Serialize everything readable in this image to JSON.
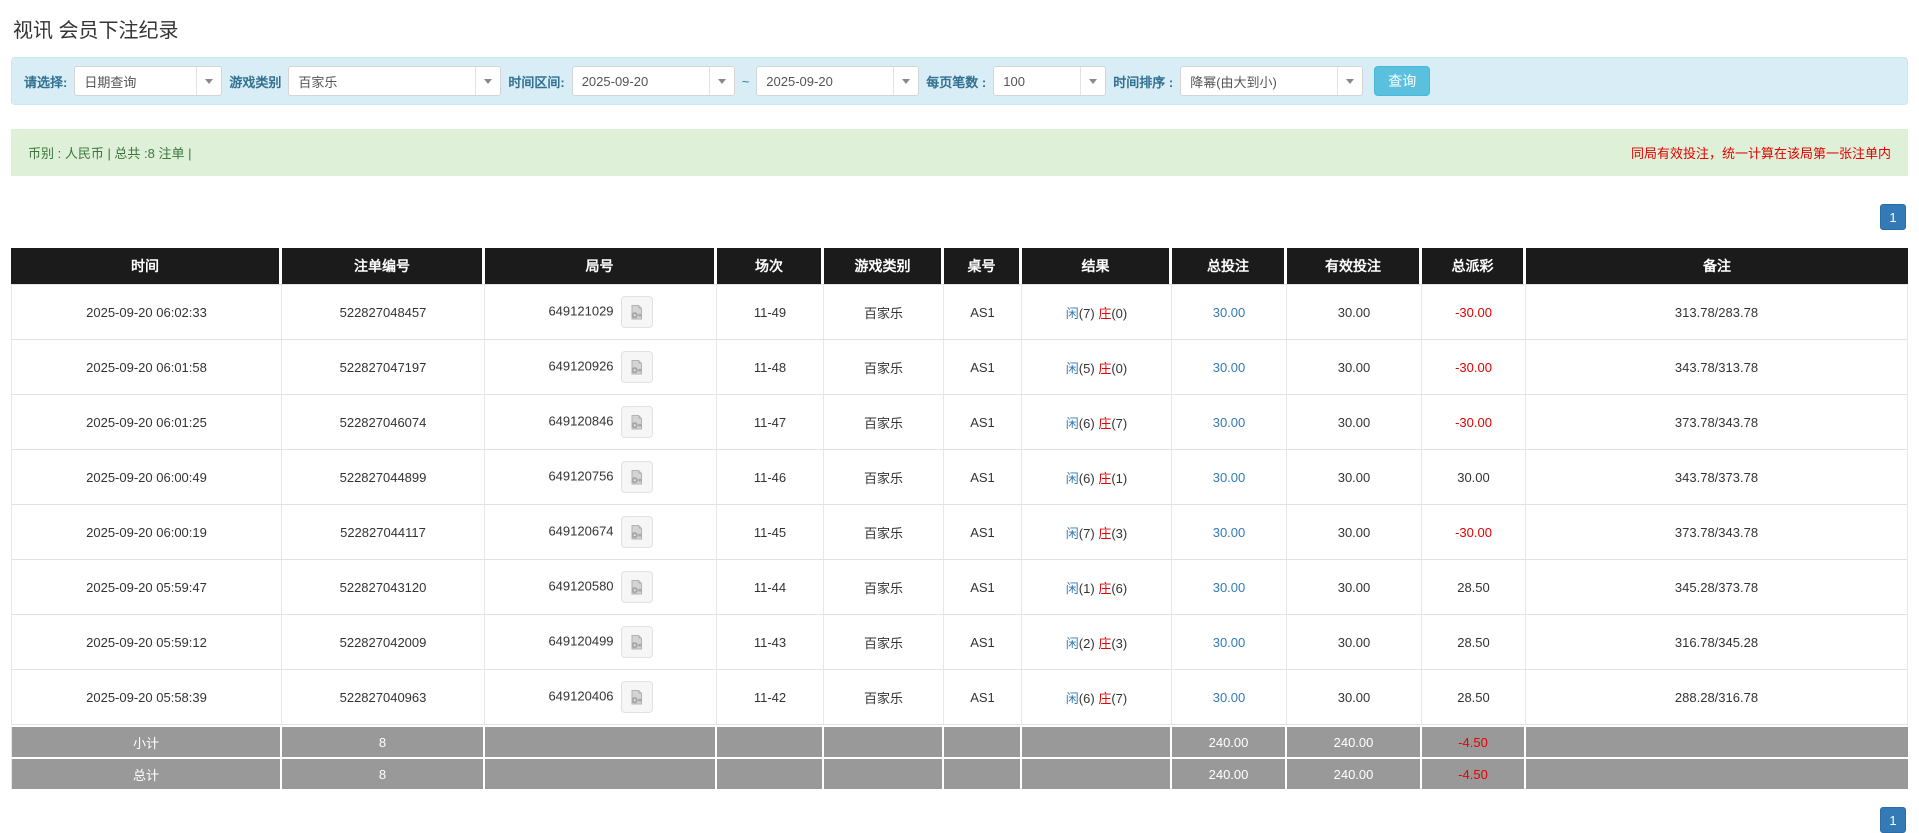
{
  "page": {
    "title": "视讯 会员下注纪录"
  },
  "filters": {
    "select_label": "请选择:",
    "select_value": "日期查询",
    "game_label": "游戏类别",
    "game_value": "百家乐",
    "range_label": "时间区间:",
    "date_from": "2025-09-20",
    "tilde": "~",
    "date_to": "2025-09-20",
    "per_page_label": "每页笔数 :",
    "per_page_value": "100",
    "sort_label": "时间排序 :",
    "sort_value": "降幂(由大到小)",
    "search_button": "查询"
  },
  "summary_bar": {
    "left": "币别 : 人民币 | 总共 :8 注单 |",
    "right": "同局有效投注，统一计算在该局第一张注单内"
  },
  "pagination": {
    "page": "1"
  },
  "table": {
    "headers": [
      "时间",
      "注单编号",
      "局号",
      "场次",
      "游戏类别",
      "桌号",
      "结果",
      "总投注",
      "有效投注",
      "总派彩",
      "备注"
    ],
    "rows": [
      {
        "time": "2025-09-20 06:02:33",
        "bet_no": "522827048457",
        "round_no": "649121029",
        "session": "11-49",
        "game": "百家乐",
        "table_no": "AS1",
        "player": "闲",
        "player_pts": "(7)",
        "banker": "庄",
        "banker_pts": "(0)",
        "total_bet": "30.00",
        "valid_bet": "30.00",
        "payout": "-30.00",
        "remark": "313.78/283.78"
      },
      {
        "time": "2025-09-20 06:01:58",
        "bet_no": "522827047197",
        "round_no": "649120926",
        "session": "11-48",
        "game": "百家乐",
        "table_no": "AS1",
        "player": "闲",
        "player_pts": "(5)",
        "banker": "庄",
        "banker_pts": "(0)",
        "total_bet": "30.00",
        "valid_bet": "30.00",
        "payout": "-30.00",
        "remark": "343.78/313.78"
      },
      {
        "time": "2025-09-20 06:01:25",
        "bet_no": "522827046074",
        "round_no": "649120846",
        "session": "11-47",
        "game": "百家乐",
        "table_no": "AS1",
        "player": "闲",
        "player_pts": "(6)",
        "banker": "庄",
        "banker_pts": "(7)",
        "total_bet": "30.00",
        "valid_bet": "30.00",
        "payout": "-30.00",
        "remark": "373.78/343.78"
      },
      {
        "time": "2025-09-20 06:00:49",
        "bet_no": "522827044899",
        "round_no": "649120756",
        "session": "11-46",
        "game": "百家乐",
        "table_no": "AS1",
        "player": "闲",
        "player_pts": "(6)",
        "banker": "庄",
        "banker_pts": "(1)",
        "total_bet": "30.00",
        "valid_bet": "30.00",
        "payout": "30.00",
        "remark": "343.78/373.78"
      },
      {
        "time": "2025-09-20 06:00:19",
        "bet_no": "522827044117",
        "round_no": "649120674",
        "session": "11-45",
        "game": "百家乐",
        "table_no": "AS1",
        "player": "闲",
        "player_pts": "(7)",
        "banker": "庄",
        "banker_pts": "(3)",
        "total_bet": "30.00",
        "valid_bet": "30.00",
        "payout": "-30.00",
        "remark": "373.78/343.78"
      },
      {
        "time": "2025-09-20 05:59:47",
        "bet_no": "522827043120",
        "round_no": "649120580",
        "session": "11-44",
        "game": "百家乐",
        "table_no": "AS1",
        "player": "闲",
        "player_pts": "(1)",
        "banker": "庄",
        "banker_pts": "(6)",
        "total_bet": "30.00",
        "valid_bet": "30.00",
        "payout": "28.50",
        "remark": "345.28/373.78"
      },
      {
        "time": "2025-09-20 05:59:12",
        "bet_no": "522827042009",
        "round_no": "649120499",
        "session": "11-43",
        "game": "百家乐",
        "table_no": "AS1",
        "player": "闲",
        "player_pts": "(2)",
        "banker": "庄",
        "banker_pts": "(3)",
        "total_bet": "30.00",
        "valid_bet": "30.00",
        "payout": "28.50",
        "remark": "316.78/345.28"
      },
      {
        "time": "2025-09-20 05:58:39",
        "bet_no": "522827040963",
        "round_no": "649120406",
        "session": "11-42",
        "game": "百家乐",
        "table_no": "AS1",
        "player": "闲",
        "player_pts": "(6)",
        "banker": "庄",
        "banker_pts": "(7)",
        "total_bet": "30.00",
        "valid_bet": "30.00",
        "payout": "28.50",
        "remark": "288.28/316.78"
      }
    ],
    "footer": [
      {
        "label": "小计",
        "count": "8",
        "total_bet": "240.00",
        "valid_bet": "240.00",
        "payout": "-4.50"
      },
      {
        "label": "总计",
        "count": "8",
        "total_bet": "240.00",
        "valid_bet": "240.00",
        "payout": "-4.50"
      }
    ]
  },
  "colors": {
    "accent_button": "#5bc0de",
    "link_blue": "#337ab7",
    "negative_red": "#e60000",
    "header_bg": "#1b1b1b",
    "footer_bg": "#999999",
    "filter_bg": "#d9edf7",
    "summary_bg": "#dff0d8",
    "summary_text": "#3c763d"
  }
}
